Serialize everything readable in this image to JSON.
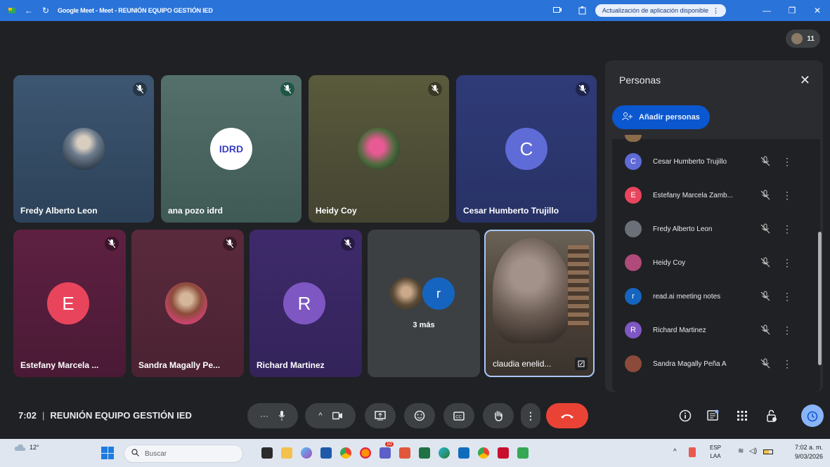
{
  "browser": {
    "title": "Google Meet - Meet - REUNIÓN EQUIPO GESTIÓN IED",
    "update_pill": "Actualización de aplicación disponible"
  },
  "top_counter": {
    "count": "11"
  },
  "tiles": {
    "t1": {
      "name": "Fredy Alberto Leon"
    },
    "t2": {
      "name": "ana pozo idrd",
      "logo_text": "IDRD"
    },
    "t3": {
      "name": "Heidy Coy"
    },
    "t4": {
      "name": "Cesar Humberto Trujillo",
      "initial": "C"
    },
    "t5": {
      "name": "Estefany Marcela ...",
      "initial": "E"
    },
    "t6": {
      "name": "Sandra Magally Pe..."
    },
    "t7": {
      "name": "Richard Martinez",
      "initial": "R"
    },
    "t8": {
      "more_label": "3 más",
      "initial": "r"
    },
    "t9": {
      "name": "claudia enelid..."
    }
  },
  "panel": {
    "title": "Personas",
    "add_label": "Añadir personas",
    "people": [
      {
        "initial": "C",
        "name": "Cesar Humberto Trujillo",
        "color": "#5f6bd6"
      },
      {
        "initial": "E",
        "name": "Estefany Marcela Zamb...",
        "color": "#e8455c"
      },
      {
        "initial": "",
        "name": "Fredy Alberto Leon",
        "color": "#6b6f78"
      },
      {
        "initial": "",
        "name": "Heidy Coy",
        "color": "#b04a7a"
      },
      {
        "initial": "r",
        "name": "read.ai meeting notes",
        "color": "#1565c0"
      },
      {
        "initial": "R",
        "name": "Richard Martinez",
        "color": "#7e57c2"
      },
      {
        "initial": "",
        "name": "Sandra Magally Peña A",
        "color": "#8c4b3a"
      }
    ]
  },
  "meeting": {
    "time": "7:02",
    "name": "REUNIÓN EQUIPO GESTIÓN IED"
  },
  "taskbar": {
    "weather": "12°",
    "search_placeholder": "Buscar",
    "lang": "ESP",
    "lang2": "LAA",
    "time": "7:02 a. m.",
    "date": "9/03/2026",
    "badge": "10"
  },
  "colors": {
    "meet_bg": "#202124",
    "end_call_red": "#ea4335",
    "accent_blue": "#0b57d0"
  }
}
